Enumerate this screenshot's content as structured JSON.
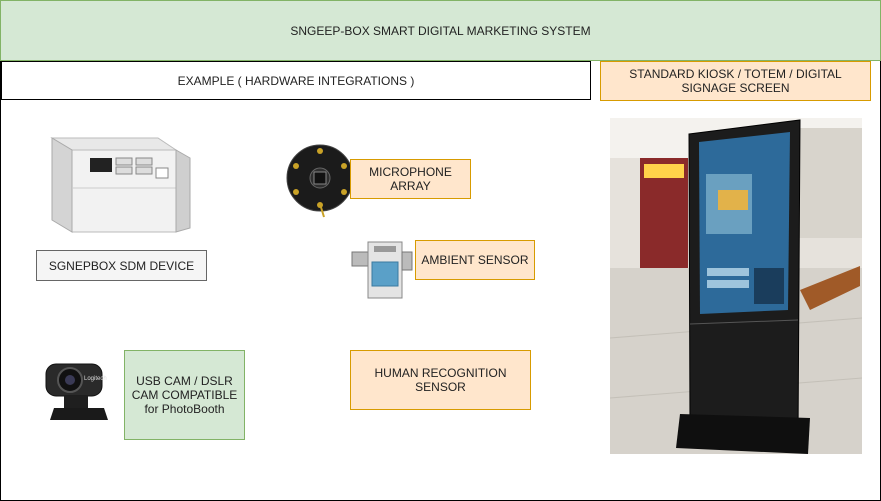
{
  "banner": {
    "title": "SNGEEP-BOX SMART DIGITAL  MARKETING SYSTEM"
  },
  "example_label": "EXAMPLE ( HARDWARE INTEGRATIONS )",
  "kiosk_label": {
    "line1": "STANDARD KIOSK / TOTEM / DIGITAL",
    "line2": "SIGNAGE SCREEN"
  },
  "device_label": "SGNEPBOX  SDM DEVICE",
  "microphone_label": {
    "line1": "MICROPHONE",
    "line2": "ARRAY"
  },
  "ambient_label": "AMBIENT SENSOR",
  "human_label": {
    "line1": "HUMAN RECOGNITION",
    "line2": "SENSOR"
  },
  "usbcam_label": {
    "line1": "USB CAM / DSLR",
    "line2": "CAM COMPATIBLE",
    "line3": "for PhotoBooth"
  },
  "webcam_brand": "Logitech",
  "colors": {
    "green_fill": "#d5e8d4",
    "green_stroke": "#82b366",
    "orange_fill": "#ffe6cc",
    "orange_stroke": "#d79b00"
  }
}
